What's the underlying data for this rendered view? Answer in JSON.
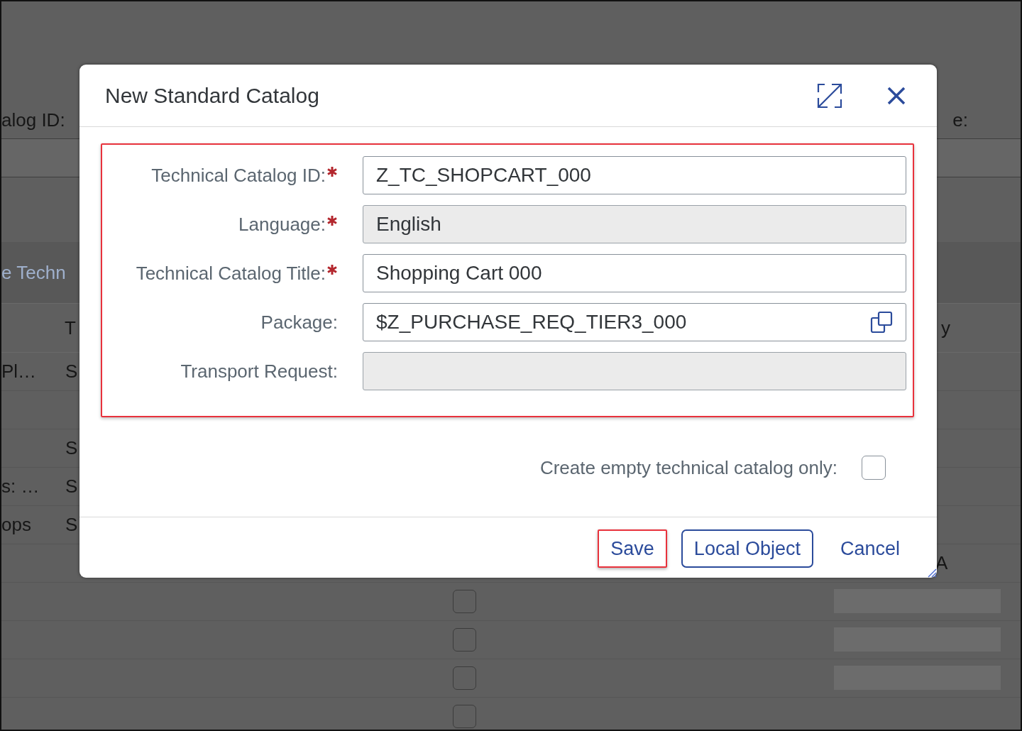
{
  "background_page": {
    "header_labels": [
      "alog ID:",
      "e:"
    ],
    "toolbar_link": "e Techn",
    "column_headers": [
      "T",
      "y"
    ],
    "rows": [
      {
        "column_1": "Pl…",
        "column_2": "S"
      },
      {},
      {
        "column_2": "S"
      },
      {
        "column_1": "s: …",
        "column_2": "S"
      },
      {
        "column_1": "ops",
        "column_2": "S"
      },
      {
        "column_4": "A"
      },
      {
        "checkbox": {
          "checked": false
        },
        "bar": true
      },
      {
        "checkbox": {
          "checked": false
        },
        "bar": true
      },
      {
        "checkbox": {
          "checked": false
        },
        "bar": true
      },
      {
        "checkbox": {
          "checked": false
        }
      }
    ]
  },
  "dialog": {
    "title": "New Standard Catalog",
    "form": {
      "highlighted": true,
      "fields": [
        {
          "label": "Technical Catalog ID:",
          "required": true,
          "value": "Z_TC_SHOPCART_000",
          "read_only": false,
          "kind": "text"
        },
        {
          "label": "Language:",
          "required": true,
          "value": "English",
          "read_only": true,
          "kind": "text"
        },
        {
          "label": "Technical Catalog Title:",
          "required": true,
          "value": "Shopping Cart 000",
          "read_only": false,
          "kind": "text"
        },
        {
          "label": "Package:",
          "required": false,
          "value": "$Z_PURCHASE_REQ_TIER3_000",
          "read_only": false,
          "kind": "value_help"
        },
        {
          "label": "Transport Request:",
          "required": false,
          "read_only": true,
          "kind": "text"
        }
      ]
    },
    "empty_catalog_option": {
      "label": "Create empty technical catalog only:",
      "checked": false
    },
    "buttons": [
      {
        "label": "Save",
        "kind": "default",
        "highlighted": true
      },
      {
        "label": "Local Object",
        "kind": "outlined",
        "highlighted": false
      },
      {
        "label": "Cancel",
        "kind": "transparent",
        "highlighted": false
      }
    ]
  }
}
